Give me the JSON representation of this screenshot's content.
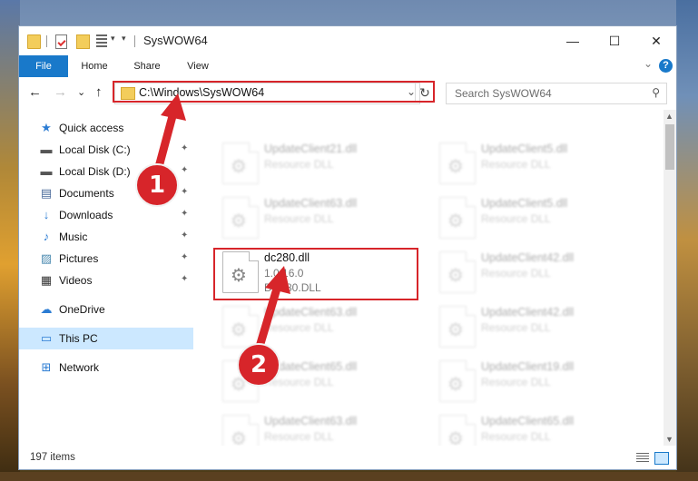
{
  "window": {
    "title": "SysWOW64"
  },
  "controls": {
    "minimize": "—",
    "maximize": "☐",
    "close": "✕"
  },
  "ribbon": {
    "tabs": [
      "File",
      "Home",
      "Share",
      "View"
    ],
    "help": "?",
    "collapse": "⌄"
  },
  "nav": {
    "back": "←",
    "forward": "→",
    "recent": "⌄",
    "up": "↑"
  },
  "address": {
    "path": "C:\\Windows\\SysWOW64",
    "refresh": "↻"
  },
  "search": {
    "placeholder": "Search SysWOW64",
    "icon": "⚲"
  },
  "sidebar": {
    "items": [
      {
        "label": "Quick access",
        "icon": "★",
        "icon_name": "star-icon",
        "color": "#2b7cd3"
      },
      {
        "label": "Local Disk (C:)",
        "icon": "▬",
        "icon_name": "drive-icon",
        "color": "#555555",
        "pinned": true
      },
      {
        "label": "Local Disk (D:)",
        "icon": "▬",
        "icon_name": "drive-icon",
        "color": "#555555",
        "pinned": true
      },
      {
        "label": "Documents",
        "icon": "▤",
        "icon_name": "documents-icon",
        "color": "#4a6a9a",
        "pinned": true
      },
      {
        "label": "Downloads",
        "icon": "↓",
        "icon_name": "download-icon",
        "color": "#2b7cd3",
        "pinned": true
      },
      {
        "label": "Music",
        "icon": "♪",
        "icon_name": "music-icon",
        "color": "#2b7cd3",
        "pinned": true
      },
      {
        "label": "Pictures",
        "icon": "▨",
        "icon_name": "pictures-icon",
        "color": "#4a8ab0",
        "pinned": true
      },
      {
        "label": "Videos",
        "icon": "▦",
        "icon_name": "videos-icon",
        "color": "#333333",
        "pinned": true
      },
      {
        "label": "OneDrive",
        "icon": "☁",
        "icon_name": "cloud-icon",
        "color": "#2b7cd3"
      },
      {
        "label": "This PC",
        "icon": "▭",
        "icon_name": "computer-icon",
        "color": "#2b7cd3"
      },
      {
        "label": "Network",
        "icon": "⊞",
        "icon_name": "network-icon",
        "color": "#2b7cd3"
      }
    ],
    "pin_glyph": "📌"
  },
  "files": [
    {
      "name": "UpdateClient21.dll",
      "line2": "Resource DLL",
      "blurred": true
    },
    {
      "name": "UpdateClient5.dll",
      "line2": "Resource DLL",
      "blurred": true
    },
    {
      "name": "UpdateClient63.dll",
      "line2": "Resource DLL",
      "blurred": true
    },
    {
      "name": "UpdateClient5.dll",
      "line2": "Resource DLL",
      "blurred": true
    },
    {
      "name": "dc280.dll",
      "line2": "1.0.16.0",
      "line3": "DC280.DLL",
      "blurred": false
    },
    {
      "name": "UpdateClient42.dll",
      "line2": "Resource DLL",
      "blurred": true
    },
    {
      "name": "UpdateClient63.dll",
      "line2": "Resource DLL",
      "blurred": true
    },
    {
      "name": "UpdateClient42.dll",
      "line2": "Resource DLL",
      "blurred": true
    },
    {
      "name": "UpdateClient65.dll",
      "line2": "Resource DLL",
      "blurred": true
    },
    {
      "name": "UpdateClient19.dll",
      "line2": "Resource DLL",
      "blurred": true
    },
    {
      "name": "UpdateClient63.dll",
      "line2": "Resource DLL",
      "blurred": true
    },
    {
      "name": "UpdateClient65.dll",
      "line2": "Resource DLL",
      "blurred": true
    }
  ],
  "status": {
    "count": "197 items"
  },
  "annotations": {
    "step1": "1",
    "step2": "2",
    "highlight_color": "#d7252a"
  }
}
